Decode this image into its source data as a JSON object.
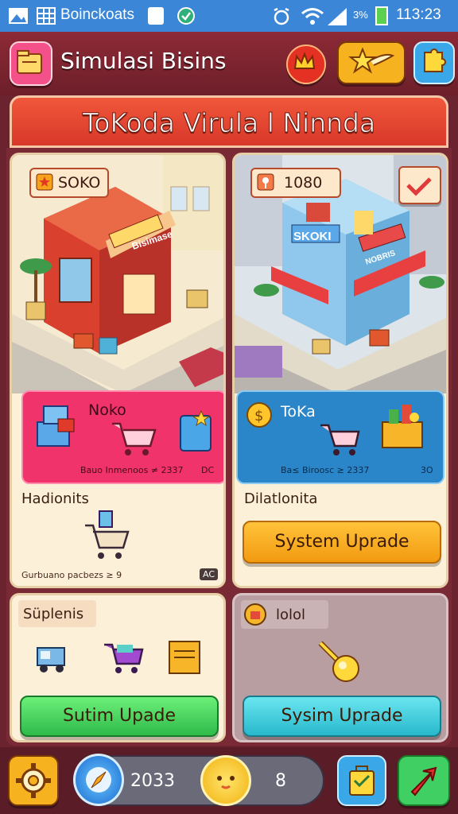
{
  "status_bar": {
    "left_text": "Boinckoats",
    "battery_text": "3%",
    "time": "113:23"
  },
  "header": {
    "title": "Simulasi Bisins",
    "icons": [
      "folder-icon",
      "crown-icon",
      "star-wing-icon",
      "puzzle-icon"
    ]
  },
  "banner": {
    "title": "ToKoda Virula l Ninnda"
  },
  "store_left": {
    "badge_value": "SOKO",
    "sign_text": "Bisimase",
    "panel_title": "Noko",
    "panel_subtitle": "Bauo Inmenoos ≠ 2337",
    "panel_corner": "DC",
    "section_label": "Hadionits",
    "footer_text": "Gurbuano pacbezs ≥ 9",
    "footer_corner": "AC"
  },
  "store_right": {
    "badge_value": "1080",
    "sign_text": "SKOKI",
    "awning_sign": "NOBRIS",
    "panel_title": "ToKa",
    "panel_subtitle": "Ba≤ Biroosc ≥ 2337",
    "panel_corner": "3O",
    "section_label": "Dilatlonita",
    "button_label": "System Uprade"
  },
  "supplies_card": {
    "label": "Süplenis",
    "button_label": "Sutim Upade"
  },
  "upgrade_card": {
    "label": "lolol",
    "button_label": "Sysim Uprade"
  },
  "bottom_bar": {
    "coins": "2033",
    "gems": "8"
  },
  "colors": {
    "frame": "#6b2330",
    "banner": "#e44a33",
    "pink_panel": "#f0336a",
    "blue_panel": "#2a86c9",
    "orange_button": "#f7a51c",
    "green_button": "#3fcf62",
    "cyan_button": "#3fc9d8"
  }
}
